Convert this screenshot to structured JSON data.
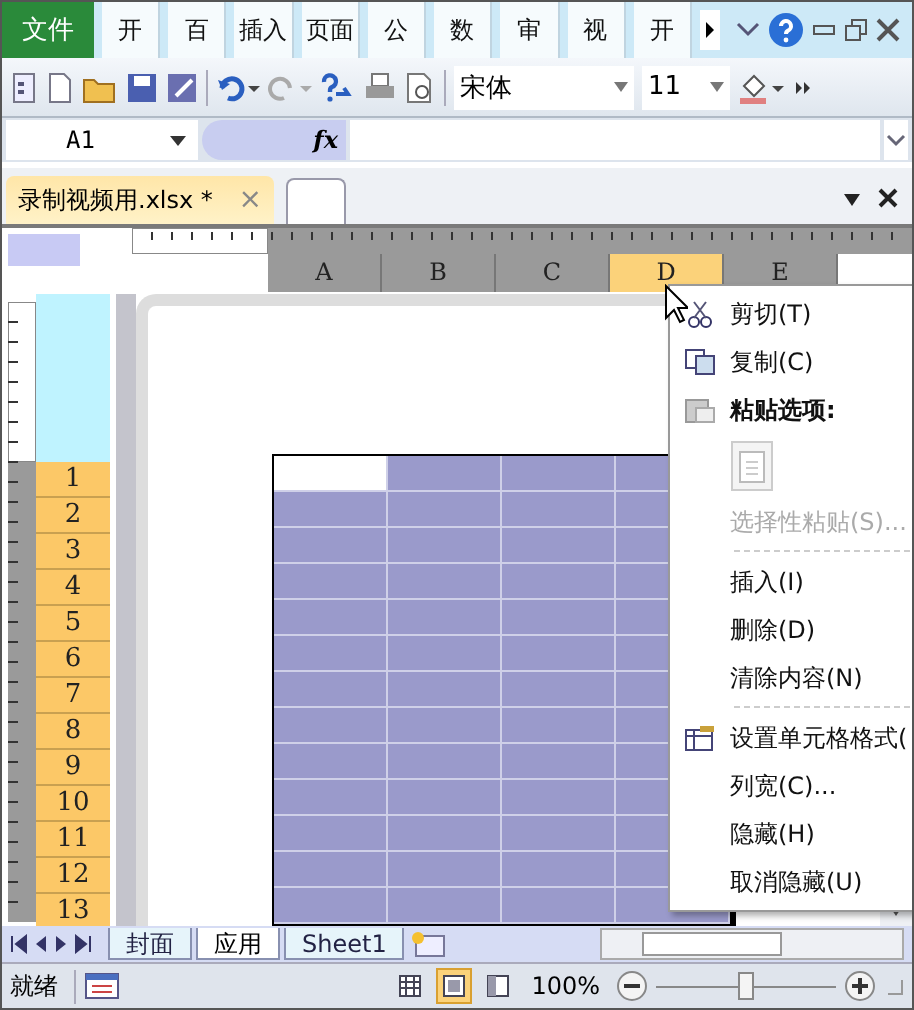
{
  "ribbon_tabs": [
    {
      "label": "文件",
      "kind": "file"
    },
    {
      "label": "开",
      "kind": "tab"
    },
    {
      "label": "百",
      "kind": "tab"
    },
    {
      "label": "插入",
      "kind": "tab"
    },
    {
      "label": "页面",
      "kind": "tab"
    },
    {
      "label": "公",
      "kind": "tab"
    },
    {
      "label": "数",
      "kind": "tab"
    },
    {
      "label": "审",
      "kind": "tab"
    },
    {
      "label": "视",
      "kind": "tab"
    },
    {
      "label": "开",
      "kind": "tab"
    }
  ],
  "toolbar": {
    "font": "宋体",
    "size": "11"
  },
  "formula_bar": {
    "name_box": "A1",
    "fx": "fx"
  },
  "workbook_tab": {
    "title": "录制视频用.xlsx *",
    "close": "×"
  },
  "column_headers": [
    {
      "label": "A",
      "selected": false
    },
    {
      "label": "B",
      "selected": false
    },
    {
      "label": "C",
      "selected": false
    },
    {
      "label": "D",
      "selected": true
    },
    {
      "label": "E",
      "selected": false
    }
  ],
  "row_headers": [
    {
      "label": "1",
      "selected": true
    },
    {
      "label": "2",
      "selected": true
    },
    {
      "label": "3",
      "selected": true
    },
    {
      "label": "4",
      "selected": true
    },
    {
      "label": "5",
      "selected": true
    },
    {
      "label": "6",
      "selected": true
    },
    {
      "label": "7",
      "selected": true
    },
    {
      "label": "8",
      "selected": true
    },
    {
      "label": "9",
      "selected": true
    },
    {
      "label": "10",
      "selected": true
    },
    {
      "label": "11",
      "selected": true
    },
    {
      "label": "12",
      "selected": true
    },
    {
      "label": "13",
      "selected": true
    }
  ],
  "grid": {
    "rows": [
      {
        "cells": [
          {
            "selected": false
          },
          {
            "selected": true
          },
          {
            "selected": true
          },
          {
            "selected": true
          }
        ]
      },
      {
        "cells": [
          {
            "selected": true
          },
          {
            "selected": true
          },
          {
            "selected": true
          },
          {
            "selected": true
          }
        ]
      },
      {
        "cells": [
          {
            "selected": true
          },
          {
            "selected": true
          },
          {
            "selected": true
          },
          {
            "selected": true
          }
        ]
      },
      {
        "cells": [
          {
            "selected": true
          },
          {
            "selected": true
          },
          {
            "selected": true
          },
          {
            "selected": true
          }
        ]
      },
      {
        "cells": [
          {
            "selected": true
          },
          {
            "selected": true
          },
          {
            "selected": true
          },
          {
            "selected": true
          }
        ]
      },
      {
        "cells": [
          {
            "selected": true
          },
          {
            "selected": true
          },
          {
            "selected": true
          },
          {
            "selected": true
          }
        ]
      },
      {
        "cells": [
          {
            "selected": true
          },
          {
            "selected": true
          },
          {
            "selected": true
          },
          {
            "selected": true
          }
        ]
      },
      {
        "cells": [
          {
            "selected": true
          },
          {
            "selected": true
          },
          {
            "selected": true
          },
          {
            "selected": true
          }
        ]
      },
      {
        "cells": [
          {
            "selected": true
          },
          {
            "selected": true
          },
          {
            "selected": true
          },
          {
            "selected": true
          }
        ]
      },
      {
        "cells": [
          {
            "selected": true
          },
          {
            "selected": true
          },
          {
            "selected": true
          },
          {
            "selected": true
          }
        ]
      },
      {
        "cells": [
          {
            "selected": true
          },
          {
            "selected": true
          },
          {
            "selected": true
          },
          {
            "selected": true
          }
        ]
      },
      {
        "cells": [
          {
            "selected": true
          },
          {
            "selected": true
          },
          {
            "selected": true
          },
          {
            "selected": true
          }
        ]
      },
      {
        "cells": [
          {
            "selected": true
          },
          {
            "selected": true
          },
          {
            "selected": true
          },
          {
            "selected": true
          }
        ]
      }
    ]
  },
  "context_menu": [
    {
      "kind": "command",
      "label": "剪切(T)",
      "disabled": false
    },
    {
      "kind": "command",
      "label": "复制(C)",
      "disabled": false
    },
    {
      "kind": "heading",
      "label": "粘贴选项:"
    },
    {
      "kind": "paste-option"
    },
    {
      "kind": "command",
      "label": "选择性粘贴(S)...",
      "disabled": true
    },
    {
      "kind": "separator"
    },
    {
      "kind": "command",
      "label": "插入(I)",
      "disabled": false
    },
    {
      "kind": "command",
      "label": "删除(D)",
      "disabled": false
    },
    {
      "kind": "command",
      "label": "清除内容(N)",
      "disabled": false
    },
    {
      "kind": "separator"
    },
    {
      "kind": "command",
      "label": "设置单元格格式(",
      "disabled": false
    },
    {
      "kind": "command",
      "label": "列宽(C)...",
      "disabled": false
    },
    {
      "kind": "command",
      "label": "隐藏(H)",
      "disabled": false
    },
    {
      "kind": "command",
      "label": "取消隐藏(U)",
      "disabled": false
    }
  ],
  "sheet_tabs": [
    {
      "label": "封面",
      "selected": false
    },
    {
      "label": "应用",
      "selected": true
    },
    {
      "label": "Sheet1",
      "selected": false
    }
  ],
  "status_bar": {
    "status": "就绪",
    "views": [
      {
        "kind": "normal",
        "selected": false
      },
      {
        "kind": "layout",
        "selected": true
      },
      {
        "kind": "break",
        "selected": false
      }
    ],
    "zoom": "100%",
    "level": 0.5
  }
}
